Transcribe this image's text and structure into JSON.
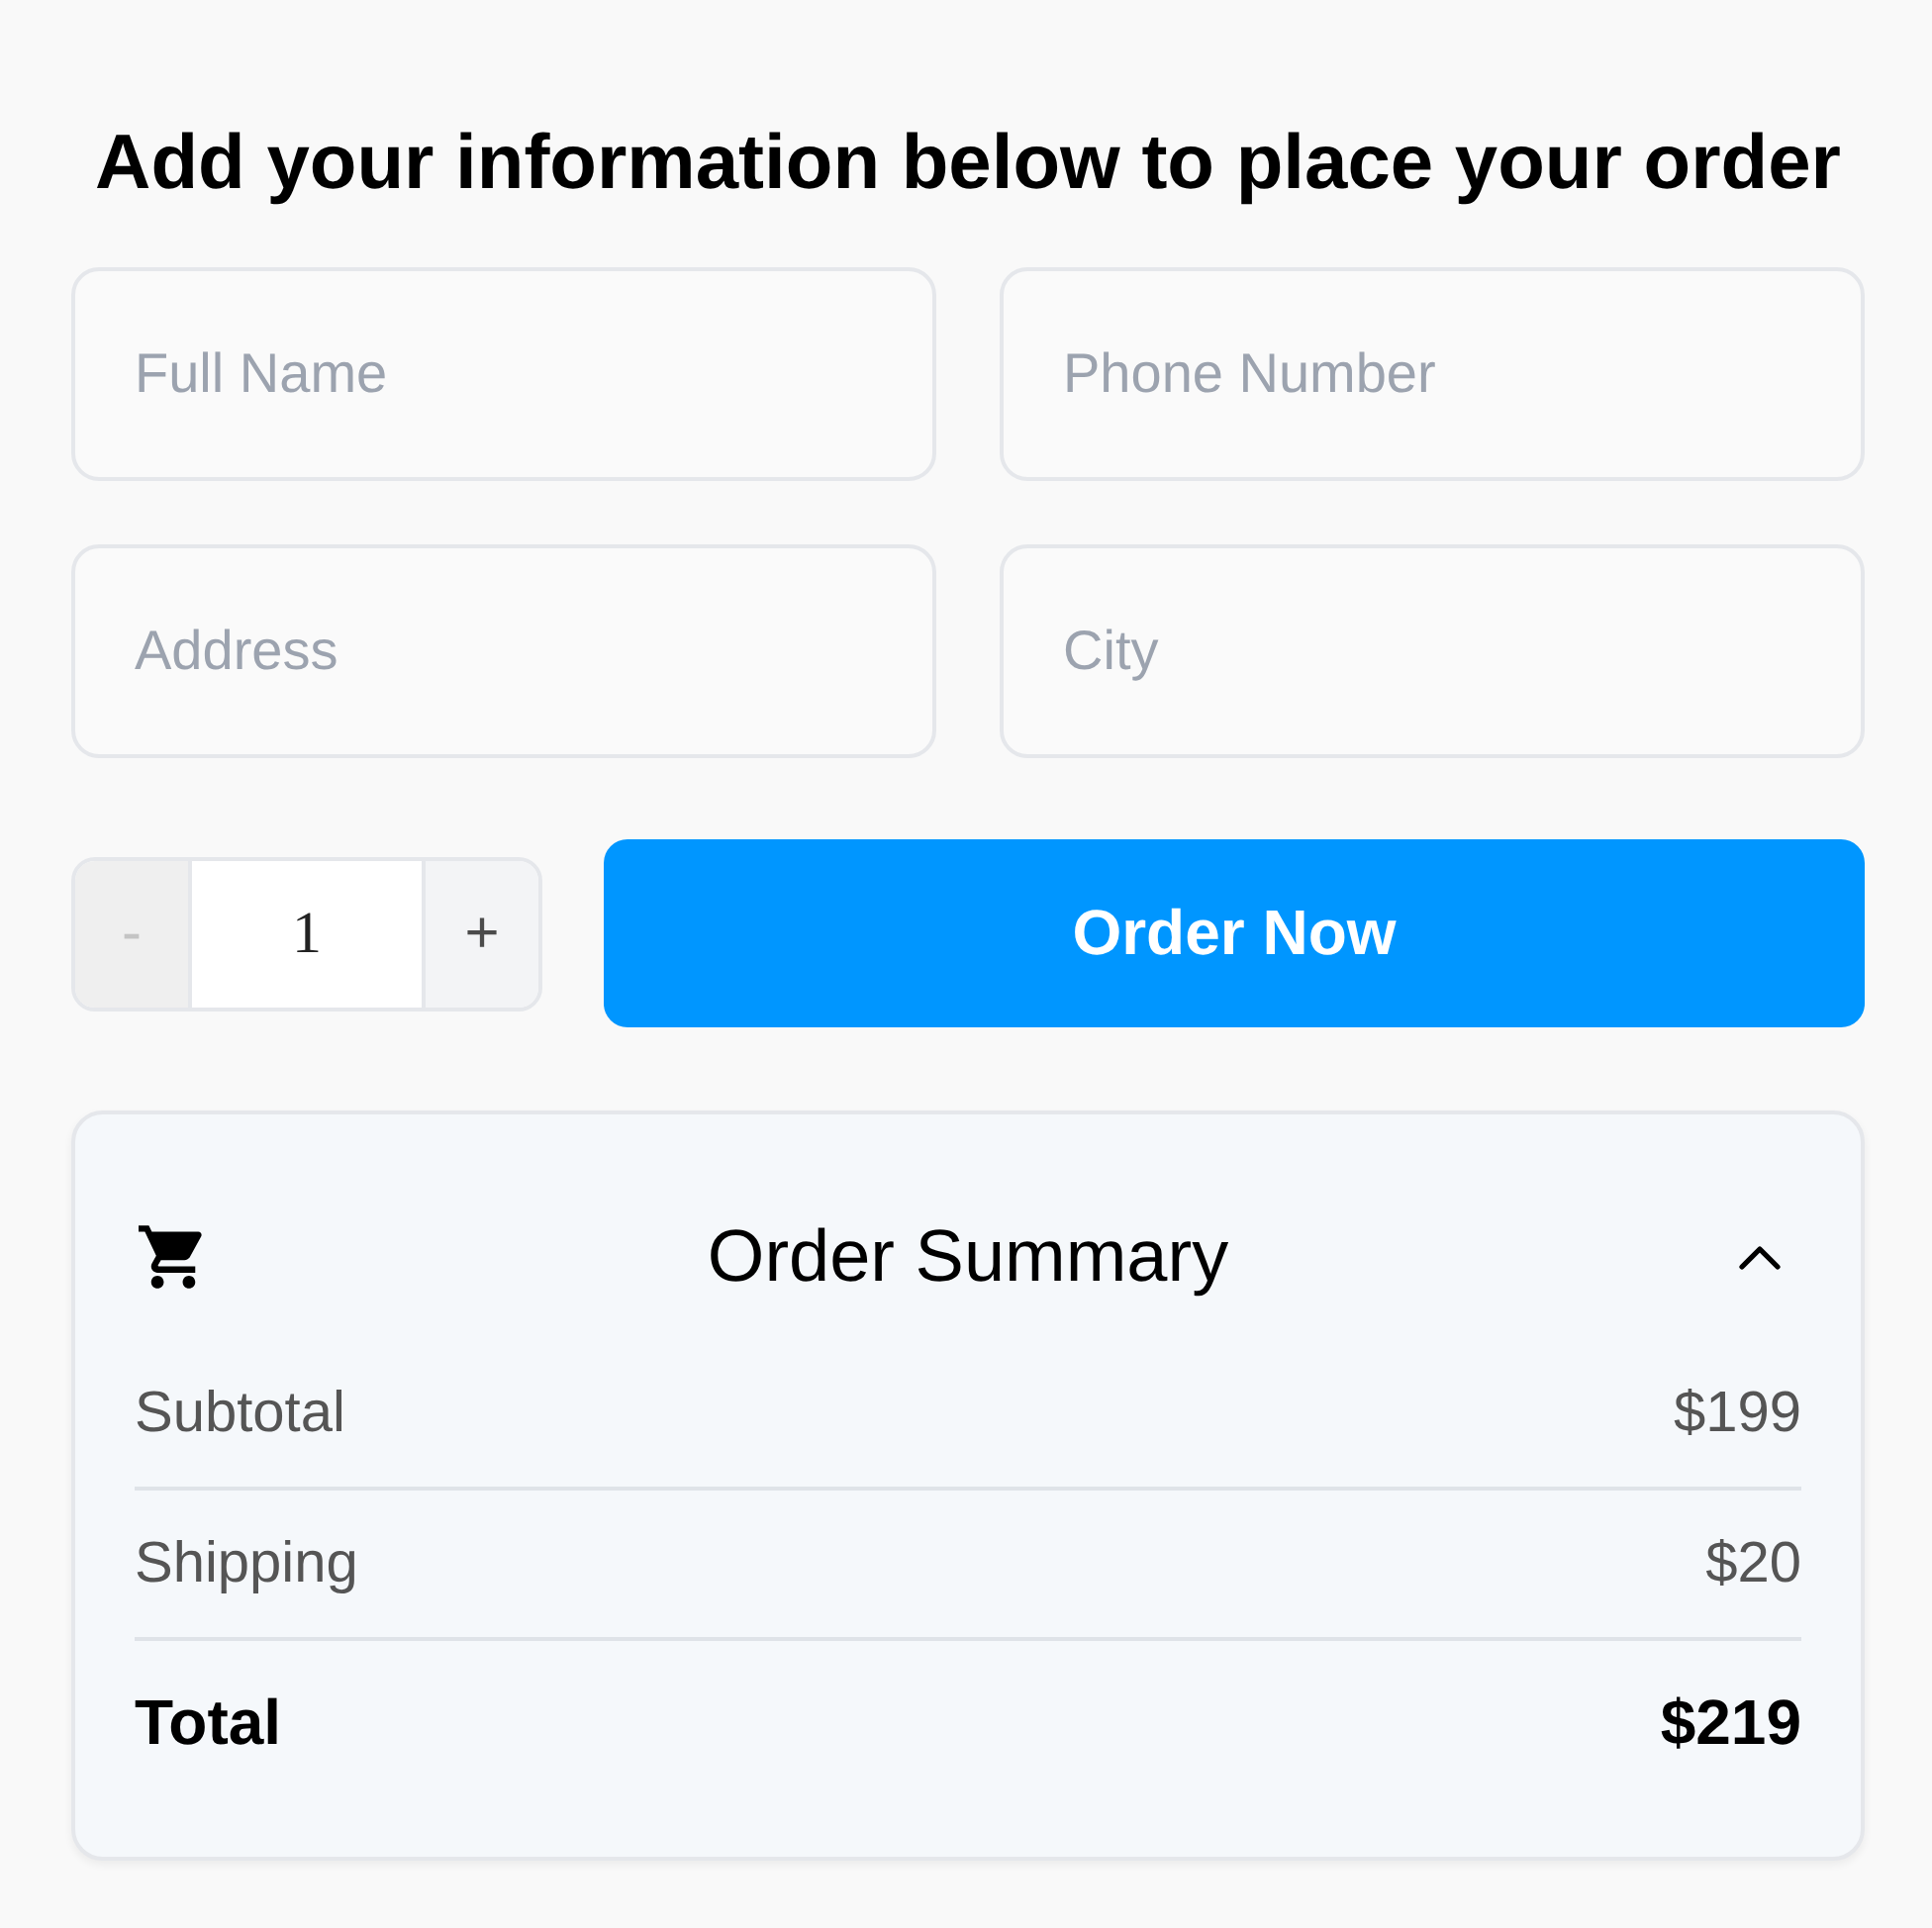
{
  "heading": "Add your information below to place your order",
  "fields": [
    {
      "placeholder": "Full Name"
    },
    {
      "placeholder": "Phone Number"
    },
    {
      "placeholder": "Address"
    },
    {
      "placeholder": "City"
    }
  ],
  "quantity": {
    "decrement": {
      "label": "-",
      "disabled": true
    },
    "value": "1",
    "increment": {
      "label": "+",
      "disabled": false
    }
  },
  "order_button": {
    "label": "Order Now"
  },
  "summary": {
    "title": "Order Summary",
    "expanded": true,
    "rows": [
      {
        "kind": "line",
        "label": "Subtotal",
        "value": "$199"
      },
      {
        "kind": "line",
        "label": "Shipping",
        "value": "$20"
      },
      {
        "kind": "total",
        "label": "Total",
        "value": "$219"
      }
    ]
  }
}
